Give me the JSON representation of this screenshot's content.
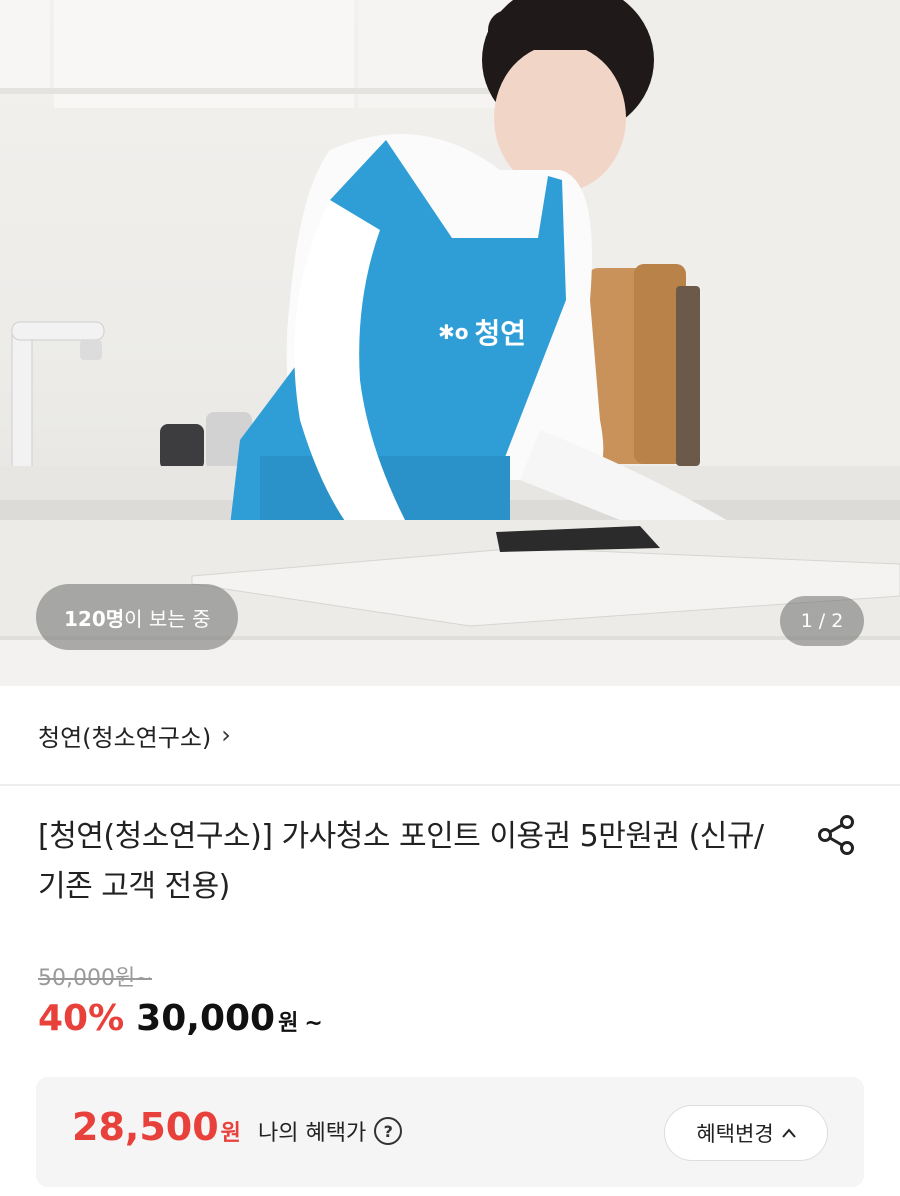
{
  "hero": {
    "apron_text": "청연",
    "viewers_count": "120명",
    "viewers_suffix": "이 보는 중",
    "page_current": "1",
    "page_separator": "/",
    "page_total": "2"
  },
  "seller": {
    "name": "청연(청소연구소)",
    "chevron": "›"
  },
  "product": {
    "title": "[청연(청소연구소)] 가사청소 포인트 이용권 5만원권 (신규/기존 고객 전용)",
    "share_icon": "share-icon"
  },
  "price": {
    "original": "50,000원",
    "original_suffix": "~",
    "discount_rate": "40%",
    "sale": "30,000",
    "sale_unit": "원",
    "sale_suffix": "~"
  },
  "benefit": {
    "price": "28,500",
    "unit": "원",
    "label": "나의 혜택가",
    "help_icon": "?",
    "change_label": "혜택변경",
    "change_icon": "^"
  },
  "colors": {
    "accent_red": "#e8413c",
    "apron_blue": "#2f9ed6",
    "box_bg": "#f5f5f5"
  }
}
